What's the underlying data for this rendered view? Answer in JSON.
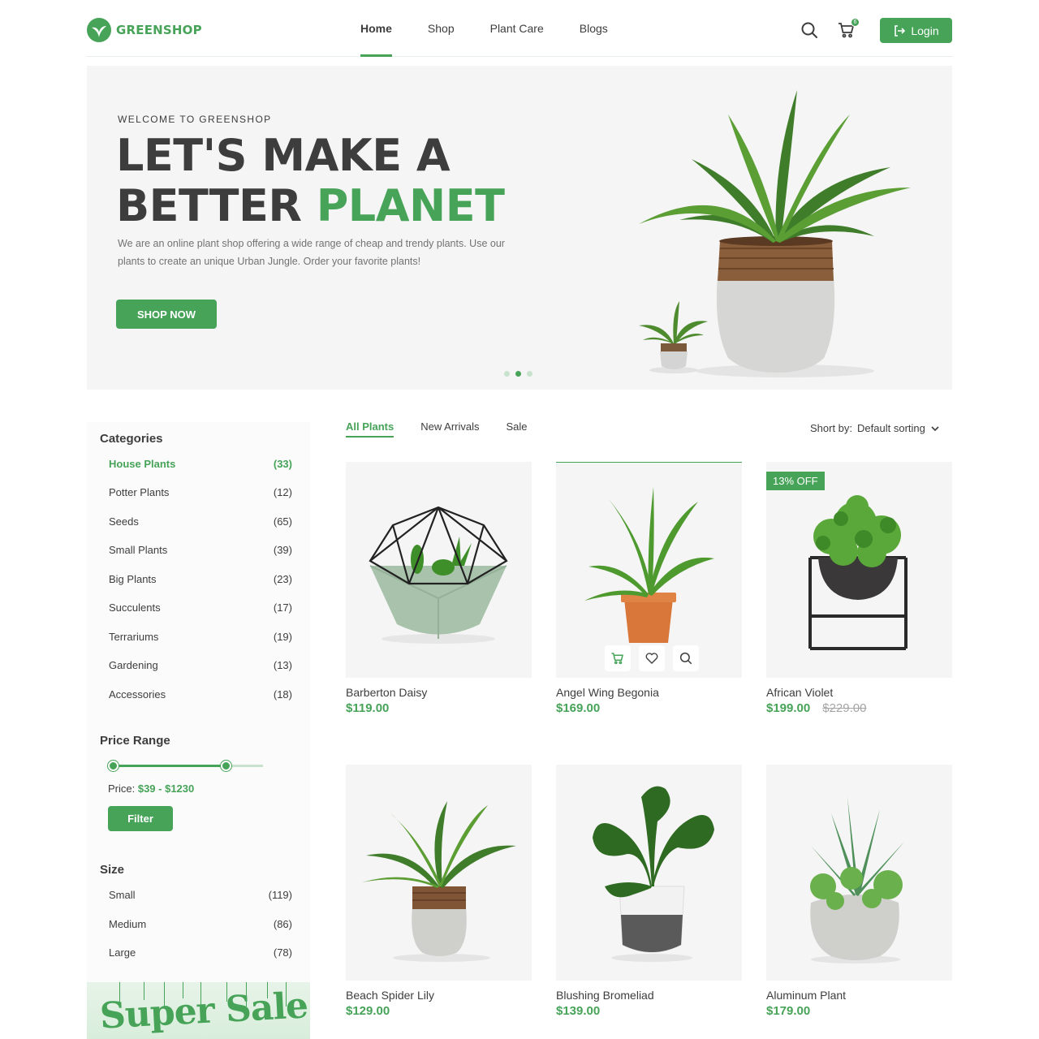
{
  "brand": {
    "name": "GREENSHOP"
  },
  "nav": {
    "items": [
      "Home",
      "Shop",
      "Plant Care",
      "Blogs"
    ],
    "active": "Home"
  },
  "header": {
    "cart_count": "6",
    "login_label": "Login"
  },
  "hero": {
    "eyebrow": "WELCOME TO GREENSHOP",
    "title_line1": "LET'S MAKE A",
    "title_line2_plain": "BETTER ",
    "title_line2_accent": "PLANET",
    "description": "We are an online plant shop offering a wide range of cheap and trendy plants. Use our plants to create an unique Urban Jungle. Order your favorite plants!",
    "cta_label": "SHOP NOW",
    "slides": 3,
    "active_slide": 2
  },
  "sidebar": {
    "categories_title": "Categories",
    "categories": [
      {
        "label": "House Plants",
        "count": "(33)",
        "active": true
      },
      {
        "label": "Potter Plants",
        "count": "(12)"
      },
      {
        "label": "Seeds",
        "count": "(65)"
      },
      {
        "label": "Small Plants",
        "count": "(39)"
      },
      {
        "label": "Big Plants",
        "count": "(23)"
      },
      {
        "label": "Succulents",
        "count": "(17)"
      },
      {
        "label": "Terrariums",
        "count": "(19)"
      },
      {
        "label": "Gardening",
        "count": "(13)"
      },
      {
        "label": "Accessories",
        "count": "(18)"
      }
    ],
    "price_title": "Price Range",
    "price_prefix": "Price: ",
    "price_value": "$39 - $1230",
    "filter_label": "Filter",
    "size_title": "Size",
    "sizes": [
      {
        "label": "Small",
        "count": "(119)"
      },
      {
        "label": "Medium",
        "count": "(86)"
      },
      {
        "label": "Large",
        "count": "(78)"
      }
    ],
    "promo_text": "Super Sale"
  },
  "tabs": {
    "items": [
      "All Plants",
      "New Arrivals",
      "Sale"
    ],
    "active": "All Plants"
  },
  "sort": {
    "label": "Short by:",
    "value": "Default sorting"
  },
  "products": [
    {
      "name": "Barberton Daisy",
      "price": "$119.00",
      "icon": "terrarium"
    },
    {
      "name": "Angel Wing Begonia",
      "price": "$169.00",
      "icon": "fern"
    },
    {
      "name": "African Violet",
      "price": "$199.00",
      "old_price": "$229.00",
      "badge": "13% OFF",
      "icon": "bowl-stand"
    },
    {
      "name": "Beach Spider Lily",
      "price": "$129.00",
      "icon": "leafy-pot"
    },
    {
      "name": "Blushing Bromeliad",
      "price": "$139.00",
      "icon": "monstera"
    },
    {
      "name": "Aluminum Plant",
      "price": "$179.00",
      "icon": "succulent-pot"
    }
  ],
  "colors": {
    "accent": "#46a358",
    "text": "#3d3d3d",
    "muted": "#727272",
    "panel": "#f5f5f5"
  }
}
